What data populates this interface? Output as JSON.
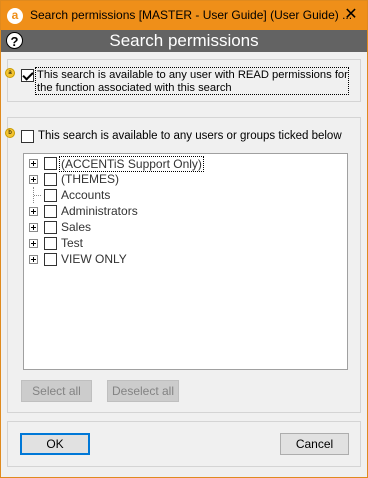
{
  "window": {
    "title": "Search permissions [MASTER - User Guide] (User Guide) ...",
    "app_icon_glyph": "a",
    "close_glyph": "✕",
    "accent_color": "#ef8f19"
  },
  "header": {
    "title": "Search permissions",
    "help_glyph": "?"
  },
  "options": {
    "read_permission": {
      "marker": "a",
      "checked": true,
      "label_line1": "This search is available to any user with READ permissions for",
      "label_line2": "the function associated with this search"
    },
    "groups": {
      "marker": "b",
      "checked": false,
      "label": "This search is available to any users or groups ticked below"
    }
  },
  "tree": {
    "items": [
      {
        "label": "(ACCENTiS Support Only)",
        "expandable": true
      },
      {
        "label": "(THEMES)",
        "expandable": true
      },
      {
        "label": "Accounts",
        "expandable": false
      },
      {
        "label": "Administrators",
        "expandable": true
      },
      {
        "label": "Sales",
        "expandable": true
      },
      {
        "label": "Test",
        "expandable": true
      },
      {
        "label": "VIEW ONLY",
        "expandable": true
      }
    ]
  },
  "buttons": {
    "select_all": "Select all",
    "deselect_all": "Deselect all",
    "ok": "OK",
    "cancel": "Cancel"
  }
}
